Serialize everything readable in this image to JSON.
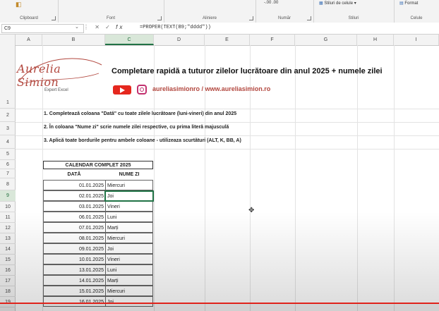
{
  "ribbon": {
    "groups": [
      {
        "label": "Clipboard"
      },
      {
        "label": "Font"
      },
      {
        "label": "Aliniere"
      },
      {
        "label": "Număr"
      },
      {
        "label": "Stiluri"
      },
      {
        "label": "Celule"
      }
    ],
    "styles_button": "Stiluri de celule",
    "format_button": "Format",
    "number_fragment": "-.00 .00"
  },
  "formula_bar": {
    "name_box": "C9",
    "cancel_symbol": "✕",
    "enter_symbol": "✓",
    "fx_symbol": "fx",
    "formula": "=PROPER(TEXT(B9;\"dddd\"))"
  },
  "columns": [
    "A",
    "B",
    "C",
    "D",
    "E",
    "F",
    "G",
    "H",
    "I"
  ],
  "selected_column": "C",
  "rows": [
    "1",
    "2",
    "3",
    "4",
    "5",
    "6",
    "7",
    "8",
    "9",
    "10",
    "11",
    "12",
    "13",
    "14",
    "15",
    "16",
    "17",
    "18",
    "19"
  ],
  "selected_row": "9",
  "logo": {
    "script": "Aurelia Simion",
    "subtitle": "Expert Excel"
  },
  "title": "Completare rapidă a tuturor zilelor lucrătoare din anul 2025 + numele zilei",
  "social": {
    "text": "aureliasimionro / www.aureliasimion.ro",
    "youtube_color": "#e5271e",
    "instagram_color": "#c2306e"
  },
  "instructions": [
    "1. Completează coloana \"Dată\" cu toate zilele lucrătoare (luni-vineri) din anul 2025",
    "2. În coloana \"Nume zi\" scrie numele zilei respective, cu prima literă majusculă",
    "3. Aplică toate bordurile pentru ambele coloane - utilizeaza scurtături (ALT, K, BB, A)"
  ],
  "table": {
    "title": "CALENDAR COMPLET 2025",
    "header_date": "DATĂ",
    "header_day": "NUME ZI",
    "rows": [
      {
        "date": "01.01.2025",
        "day": "Miercuri"
      },
      {
        "date": "02.01.2025",
        "day": "Joi"
      },
      {
        "date": "03.01.2025",
        "day": "Vineri"
      },
      {
        "date": "06.01.2025",
        "day": "Luni"
      },
      {
        "date": "07.01.2025",
        "day": "Marți"
      },
      {
        "date": "08.01.2025",
        "day": "Miercuri"
      },
      {
        "date": "09.01.2025",
        "day": "Joi"
      },
      {
        "date": "10.01.2025",
        "day": "Vineri"
      },
      {
        "date": "13.01.2025",
        "day": "Luni"
      },
      {
        "date": "14.01.2025",
        "day": "Marți"
      },
      {
        "date": "15.01.2025",
        "day": "Miercuri"
      },
      {
        "date": "16.01.2025",
        "day": "Joi"
      }
    ]
  },
  "colors": {
    "accent": "#217346",
    "brand": "#b2473e",
    "progress": "#e0231b"
  }
}
